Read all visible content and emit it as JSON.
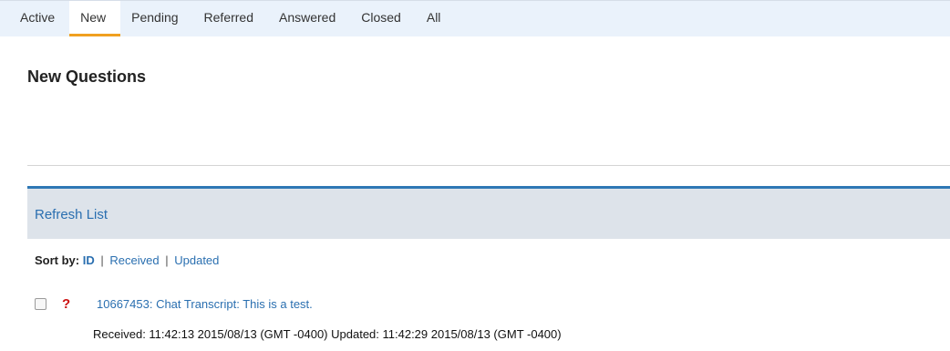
{
  "tabs": [
    {
      "label": "Active"
    },
    {
      "label": "New",
      "active": true
    },
    {
      "label": "Pending"
    },
    {
      "label": "Referred"
    },
    {
      "label": "Answered"
    },
    {
      "label": "Closed"
    },
    {
      "label": "All"
    }
  ],
  "page": {
    "title": "New Questions"
  },
  "toolbar": {
    "refresh_label": "Refresh List"
  },
  "sort": {
    "label": "Sort by:",
    "options": [
      "ID",
      "Received",
      "Updated"
    ],
    "separator": "|",
    "current": "ID"
  },
  "questions": [
    {
      "status_icon": "?",
      "link": "10667453: Chat Transcript: This is a test.",
      "meta": "Received: 11:42:13 2015/08/13 (GMT -0400) Updated: 11:42:29 2015/08/13 (GMT -0400)"
    }
  ],
  "colors": {
    "accent": "#2a6fb0",
    "active_tab_underline": "#f0a020",
    "status_red": "#cc1111"
  }
}
